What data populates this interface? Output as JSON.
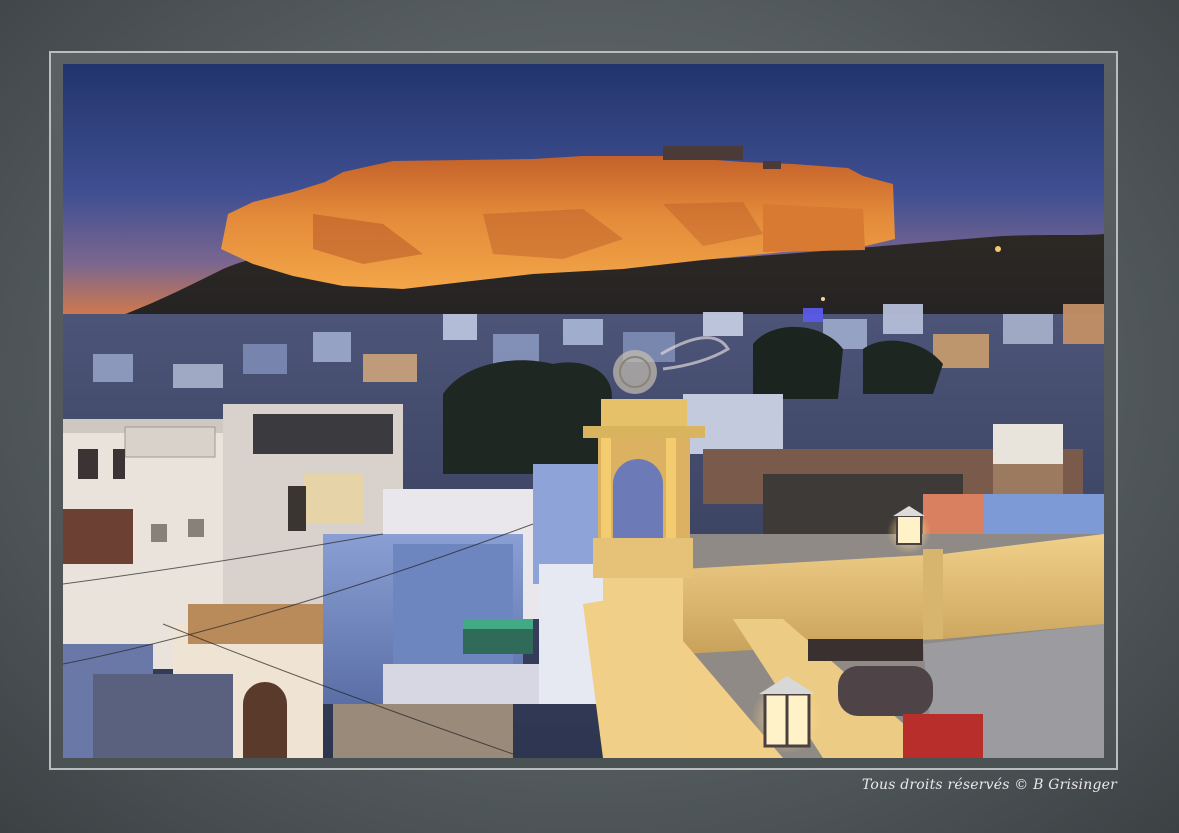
{
  "photo": {
    "subject": "fort-at-dusk-over-city",
    "colors": {
      "sky_top": "#2a3f7a",
      "sky_mid": "#4a5a9a",
      "sky_horizon": "#e07a3a",
      "fort_lit": "#d7772a",
      "fort_glow": "#f0a04a",
      "hill": "#2a2620",
      "city_blue": "#7f96c4",
      "wall_warm": "#e0c078",
      "lamp": "#fff2c8"
    }
  },
  "watermark": {
    "text": "Tous droits réservés © B Grisinger"
  },
  "frame": {
    "border_color": "#b9bdbd",
    "mat_color": "#575e60"
  }
}
